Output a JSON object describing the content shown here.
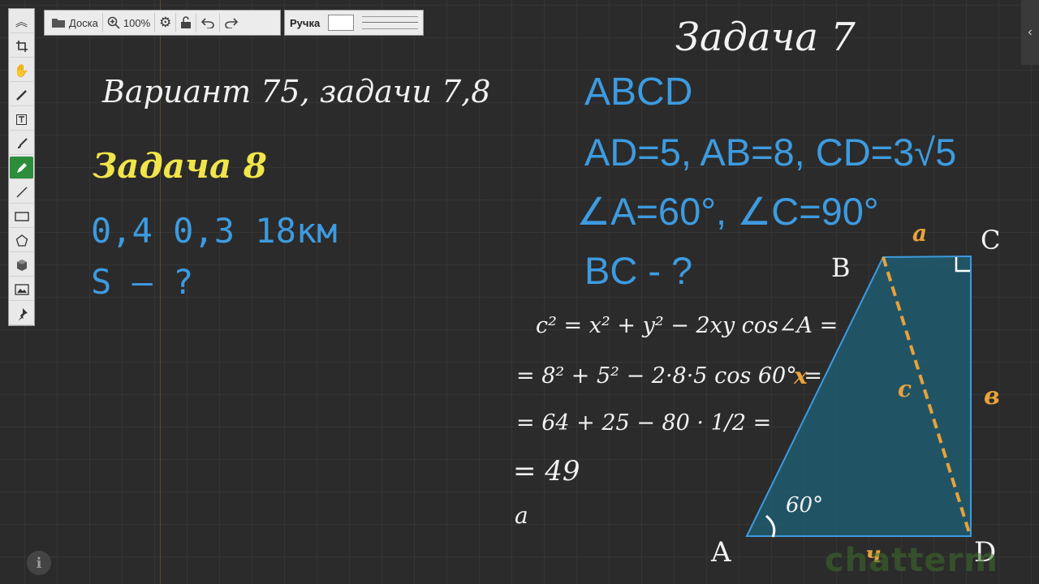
{
  "toolbar": {
    "board_label": "Доска",
    "zoom_label": "100%",
    "pen_label": "Ручка"
  },
  "palette": {
    "tools": [
      "collapse-icon",
      "crop-icon",
      "hand-icon",
      "marker-icon",
      "text-icon",
      "brush-icon",
      "pen-icon",
      "line-icon",
      "rectangle-icon",
      "polygon-icon",
      "cube-icon",
      "image-icon",
      "pin-icon"
    ],
    "active_tool": "pen-icon"
  },
  "board": {
    "heading": "Вариант 75, задачи 7,8",
    "task7_title": "Задача 7",
    "task8_title": "Задача 8",
    "task8_line1": "0,4  0,3  18км",
    "task8_line2": "S – ?",
    "abcd": "ABCD",
    "given_sides": "AD=5, AB=8, CD=3√5",
    "given_angles": "∠A=60°, ∠C=90°",
    "question": "BC - ?",
    "eq1": "c² = x² + y² − 2xy cos∠A =",
    "eq2": "= 8² + 5² − 2·8·5 cos 60° =",
    "eq2_note": "x",
    "eq3": "= 64 + 25 − 80 · 1/2 =",
    "eq4": "= 49",
    "eq5": "a",
    "labels": {
      "A": "A",
      "B": "B",
      "C": "C",
      "D": "D",
      "side_a": "a",
      "side_b": "в",
      "side_c": "c",
      "side_y": "ч",
      "angle": "60°"
    }
  },
  "colors": {
    "blue": "#3d9be0",
    "yellow": "#f0e54a",
    "orange": "#e8a23a",
    "active_tool": "#2c8d3a"
  },
  "watermark": "chatterm"
}
